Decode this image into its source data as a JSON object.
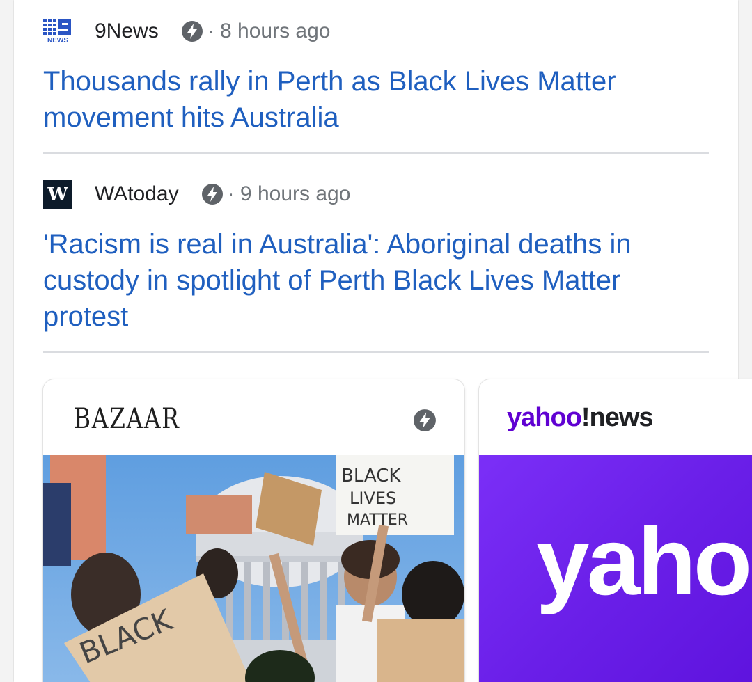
{
  "articles": [
    {
      "source": "9News",
      "logo_text": "NEWS",
      "time": "· 8 hours ago",
      "headline": "Thousands rally in Perth as Black Lives Matter movement hits Australia"
    },
    {
      "source": "WAtoday",
      "logo_text": "W",
      "time": "· 9 hours ago",
      "headline": "'Racism is real in Australia': Aboriginal deaths in custody in spotlight of Perth Black Lives Matter protest"
    }
  ],
  "stories": [
    {
      "publisher": "BAZAAR",
      "photo_signs": [
        "BLACK",
        "LIVES",
        "MATTER",
        "BLACK"
      ]
    },
    {
      "publisher_part1": "yahoo",
      "publisher_part2": "!news",
      "panel_text": "yaho"
    }
  ],
  "colors": {
    "headline": "#1f5fbf",
    "meta_text": "#70757a",
    "source_text": "#202124",
    "yahoo_purple": "#6001d2",
    "divider": "#dadce0"
  },
  "icons": {
    "amp": "lightning-bolt-icon"
  }
}
